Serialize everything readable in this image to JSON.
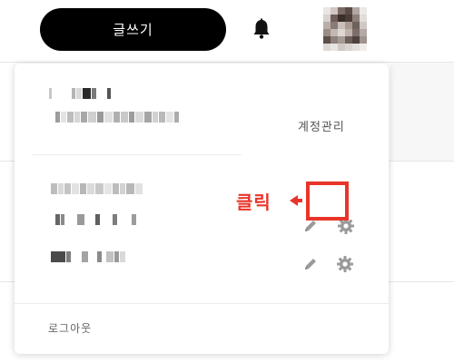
{
  "header": {
    "write_label": "글쓰기",
    "bell_icon": "bell-icon",
    "avatar_icon": "avatar"
  },
  "dropdown": {
    "manage_label": "계정관리",
    "logout_label": "로그아웃",
    "blog_rows": [
      {
        "edit_icon": "pencil-icon",
        "settings_icon": "gear-icon"
      },
      {
        "edit_icon": "pencil-icon",
        "settings_icon": "gear-icon"
      }
    ]
  },
  "annotation": {
    "click_label": "클릭",
    "color": "#e8352a"
  },
  "colors": {
    "write_button_bg": "#000000",
    "accent": "#e8352a",
    "icon_gray": "#9a9a9a"
  }
}
